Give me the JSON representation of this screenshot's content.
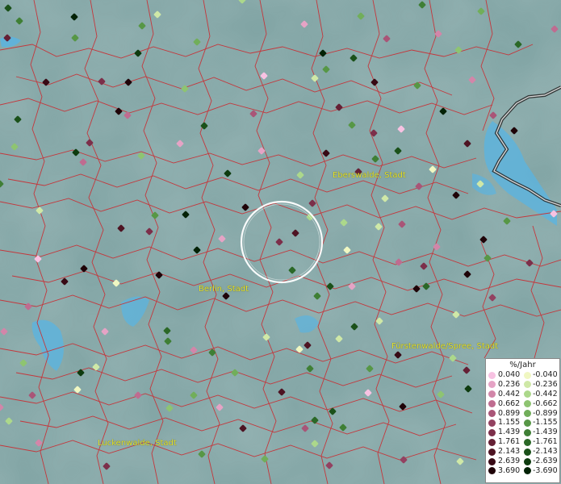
{
  "map": {
    "cities": [
      {
        "name": "Eberswalde, Stadt"
      },
      {
        "name": "Berlin, Stadt"
      },
      {
        "name": "Fürstenwalde/Spree, Stadt"
      },
      {
        "name": "Luckenwalde, Stadt"
      }
    ]
  },
  "legend": {
    "title": "%/Jahr",
    "positive": [
      {
        "label": "0.040",
        "color": "#f7c2e2"
      },
      {
        "label": "0.236",
        "color": "#e5a3c5"
      },
      {
        "label": "0.442",
        "color": "#d286a9"
      },
      {
        "label": "0.662",
        "color": "#bf6c90"
      },
      {
        "label": "0.899",
        "color": "#a95577"
      },
      {
        "label": "1.155",
        "color": "#934261"
      },
      {
        "label": "1.439",
        "color": "#7c2f4a"
      },
      {
        "label": "1.761",
        "color": "#652035"
      },
      {
        "label": "2.143",
        "color": "#4e1423"
      },
      {
        "label": "2.639",
        "color": "#380a15"
      },
      {
        "label": "3.690",
        "color": "#1f0308"
      }
    ],
    "negative": [
      {
        "label": "-0.040",
        "color": "#f0f7c2"
      },
      {
        "label": "-0.236",
        "color": "#cfe8a7"
      },
      {
        "label": "-0.442",
        "color": "#acd88b"
      },
      {
        "label": "-0.662",
        "color": "#8ec471"
      },
      {
        "label": "-0.899",
        "color": "#71ae5a"
      },
      {
        "label": "-1.155",
        "color": "#579746"
      },
      {
        "label": "-1.439",
        "color": "#3f7f35"
      },
      {
        "label": "-1.761",
        "color": "#2b6827"
      },
      {
        "label": "-2.143",
        "color": "#1b511a"
      },
      {
        "label": "-2.639",
        "color": "#0e3b0f"
      },
      {
        "label": "-3.690",
        "color": "#032206"
      }
    ]
  },
  "colors": {
    "boundary": "#c4373c",
    "water": "#5bb4e0",
    "ground": "#7fa3a3",
    "city_label": "#e5e52a",
    "selection_ring": "#ffffff"
  }
}
